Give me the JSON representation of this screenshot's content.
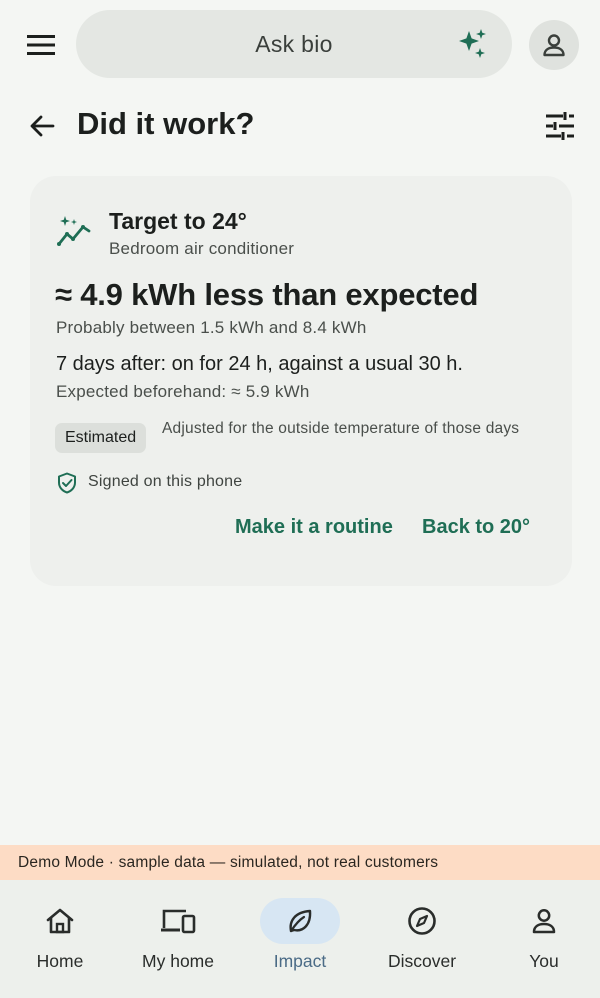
{
  "topbar": {
    "menu_icon": "hamburger-menu-icon",
    "search_label": "Ask bio",
    "sparkle_icon": "sparkle-icon",
    "avatar_icon": "person-icon"
  },
  "header": {
    "back_icon": "arrow-back-icon",
    "title": "Did it work?",
    "filter_icon": "tune-sliders-icon"
  },
  "card": {
    "icon": "trend-sparkle-icon",
    "title": "Target to 24°",
    "subtitle": "Bedroom air conditioner",
    "headline": "≈ 4.9 kWh less than expected",
    "range": "Probably between 1.5 kWh and 8.4 kWh",
    "after": "7 days after: on for 24 h, against a usual 30 h.",
    "expected": "Expected beforehand: ≈ 5.9 kWh",
    "badge": "Estimated",
    "badge_note": "Adjusted for the outside temperature of those days",
    "signed": "Signed on this phone",
    "actions": {
      "routine": "Make it a routine",
      "back": "Back to 20°"
    }
  },
  "demo_banner": "Demo Mode · sample data — simulated, not real customers",
  "nav": {
    "items": [
      {
        "label": "Home",
        "icon": "home-icon"
      },
      {
        "label": "My home",
        "icon": "devices-icon"
      },
      {
        "label": "Impact",
        "icon": "leaf-icon",
        "active": true
      },
      {
        "label": "Discover",
        "icon": "compass-icon"
      },
      {
        "label": "You",
        "icon": "person-icon"
      }
    ]
  },
  "colors": {
    "accent": "#1f6e55",
    "banner": "#fddcc5",
    "active_nav": "#d7e6f3"
  }
}
